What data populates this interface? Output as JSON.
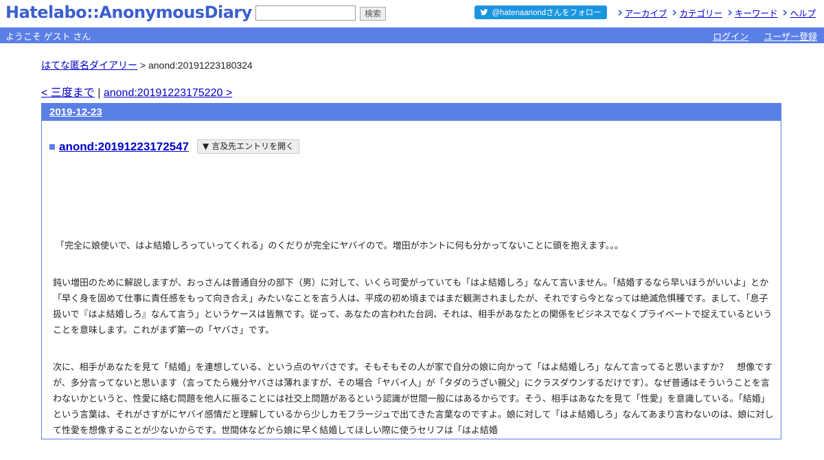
{
  "header": {
    "logo": "Hatelabo::AnonymousDiary",
    "search_value": "",
    "search_button": "検索",
    "follow_label": "@hatenaanondさんをフォロー",
    "nav": [
      "アーカイブ",
      "カテゴリー",
      "キーワード",
      "ヘルプ"
    ]
  },
  "welcome": {
    "guest": "ようこそ ゲスト さん",
    "login": "ログイン",
    "register": "ユーザー登録"
  },
  "breadcrumb": {
    "home": "はてな匿名ダイアリー",
    "separator": ">",
    "current": "anond:20191223180324"
  },
  "pager": {
    "prev": "< 三度まで",
    "separator": "|",
    "next": "anond:20191223175220 >"
  },
  "day": {
    "date": "2019-12-23",
    "entry_title": "anond:20191223172547",
    "ref_button": "▼ 言及先エントリを開く",
    "paragraphs": [
      "「完全に娘使いで、はよ結婚しろっていってくれる」のくだりが完全にヤバイので。増田がホントに何も分かってないことに頭を抱えます。。。",
      "鈍い増田のために解説しますが、おっさんは普通自分の部下（男）に対して、いくら可愛がっていても「はよ結婚しろ」なんて言いません。「結婚するなら早いほうがいいよ」とか「早く身を固めて仕事に責任感をもって向き合え」みたいなことを言う人は、平成の初め頃まではまだ観測されましたが、それですら今となっては絶滅危惧種です。まして、「息子扱いで『はよ結婚しろ』なんて言う」というケースは皆無です。従って、あなたの言われた台詞、それは、相手があなたとの関係をビジネスでなくプライベートで捉えているということを意味します。これがまず第一の「ヤバさ」です。",
      "次に、相手があなたを見て「結婚」を連想している、という点のヤバさです。そもそもその人が家で自分の娘に向かって「はよ結婚しろ」なんて言ってると思いますか？　想像ですが、多分言ってないと思います（言ってたら幾分ヤバさは薄れますが、その場合「ヤバイ人」が「タダのうざい親父」にクラスダウンするだけです）。なぜ普通はそういうことを言わないかというと、性愛に絡む問題を他人に振ることには社交上問題があるという認識が世間一般にはあるからです。そう、相手はあなたを見て「性愛」を意識している。「結婚」という言葉は、それがさすがにヤバイ感情だと理解しているから少しカモフラージュで出てきた言葉なのですよ。娘に対して「はよ結婚しろ」なんてあまり言わないのは、娘に対して性愛を想像することが少ないからです。世間体などから娘に早く結婚してほしい際に使うセリフは「はよ結婚"
    ]
  },
  "colors": {
    "brand_blue": "#5a7fe6",
    "link": "#0000cc",
    "twitter": "#1b95e0"
  },
  "icons": [
    "twitter-bird-icon",
    "nav-arrow-icon",
    "entry-square-icon"
  ]
}
